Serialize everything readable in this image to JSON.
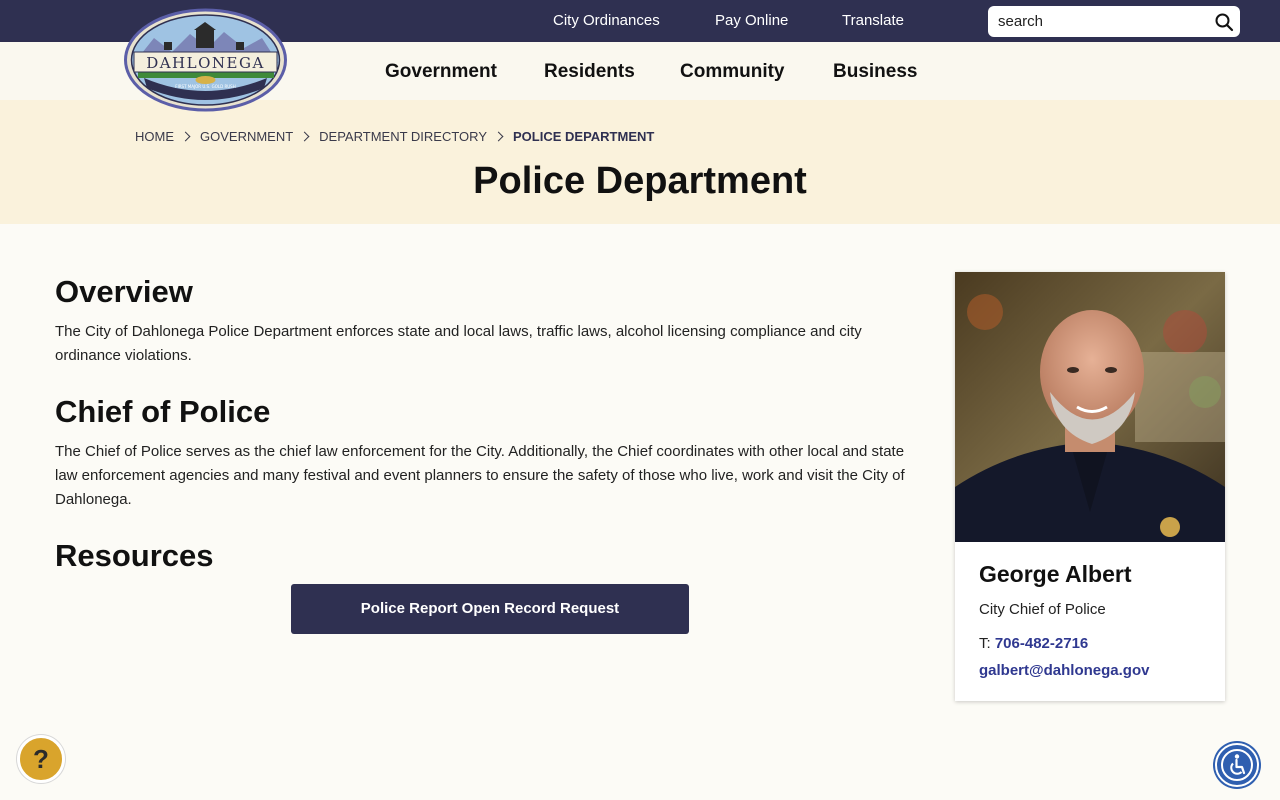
{
  "utility": {
    "links": [
      "City Ordinances",
      "Pay Online",
      "Translate"
    ],
    "search_placeholder": "search"
  },
  "logo": {
    "name": "DAHLONEGA",
    "tagline": "FIRST MAJOR U.S. GOLD RUSH"
  },
  "nav": {
    "items": [
      "Government",
      "Residents",
      "Community",
      "Business"
    ]
  },
  "breadcrumb": {
    "items": [
      "HOME",
      "GOVERNMENT",
      "DEPARTMENT DIRECTORY"
    ],
    "current": "POLICE DEPARTMENT"
  },
  "page": {
    "title": "Police Department"
  },
  "sections": {
    "overview": {
      "heading": "Overview",
      "text": "The City of Dahlonega Police Department enforces state and local laws, traffic laws, alcohol licensing compliance and city ordinance violations."
    },
    "chief": {
      "heading": "Chief of Police",
      "text": "The Chief of Police serves as the chief law enforcement for the City.  Additionally, the Chief coordinates with other local and state law enforcement agencies and many festival and event planners to ensure the safety of those who live, work and visit the City of Dahlonega."
    },
    "resources": {
      "heading": "Resources",
      "button_label": "Police Report Open Record Request"
    }
  },
  "profile": {
    "name": "George Albert",
    "role": "City Chief of Police",
    "phone_prefix": "T: ",
    "phone": "706-482-2716",
    "email": "galbert@dahlonega.gov"
  },
  "floating": {
    "help_label": "?",
    "help_color": "#d9a42c",
    "accessibility_color": "#2f5fb0"
  },
  "colors": {
    "brand_navy": "#2f3051",
    "hero_bg": "#faf2dc",
    "link_blue": "#2f3890"
  }
}
